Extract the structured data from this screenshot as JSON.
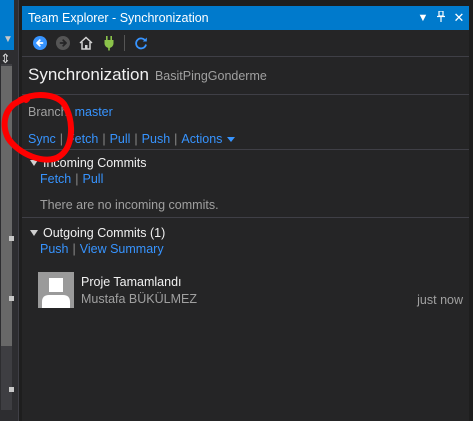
{
  "window": {
    "title": "Team Explorer - Synchronization"
  },
  "header": {
    "title": "Synchronization",
    "subtitle": "BasitPingGonderme"
  },
  "branch": {
    "label": "Branch:",
    "name": "master"
  },
  "actions": {
    "sync": "Sync",
    "fetch": "Fetch",
    "pull": "Pull",
    "push": "Push",
    "actions": "Actions"
  },
  "incoming": {
    "title": "Incoming Commits",
    "fetch": "Fetch",
    "pull": "Pull",
    "empty": "There are no incoming commits."
  },
  "outgoing": {
    "title": "Outgoing Commits (1)",
    "push": "Push",
    "view_summary": "View Summary",
    "commits": [
      {
        "title": "Proje Tamamlandı",
        "author": "Mustafa BÜKÜLMEZ",
        "time": "just now"
      }
    ]
  },
  "icons": {
    "back": "back-arrow-icon",
    "forward": "forward-arrow-icon",
    "home": "home-icon",
    "connect": "plug-icon",
    "refresh": "refresh-icon",
    "dropdown": "dropdown-icon",
    "pin": "pin-icon",
    "close": "close-icon"
  },
  "colors": {
    "accent": "#007acc",
    "link": "#3794ff",
    "annotation": "#ff0000"
  }
}
